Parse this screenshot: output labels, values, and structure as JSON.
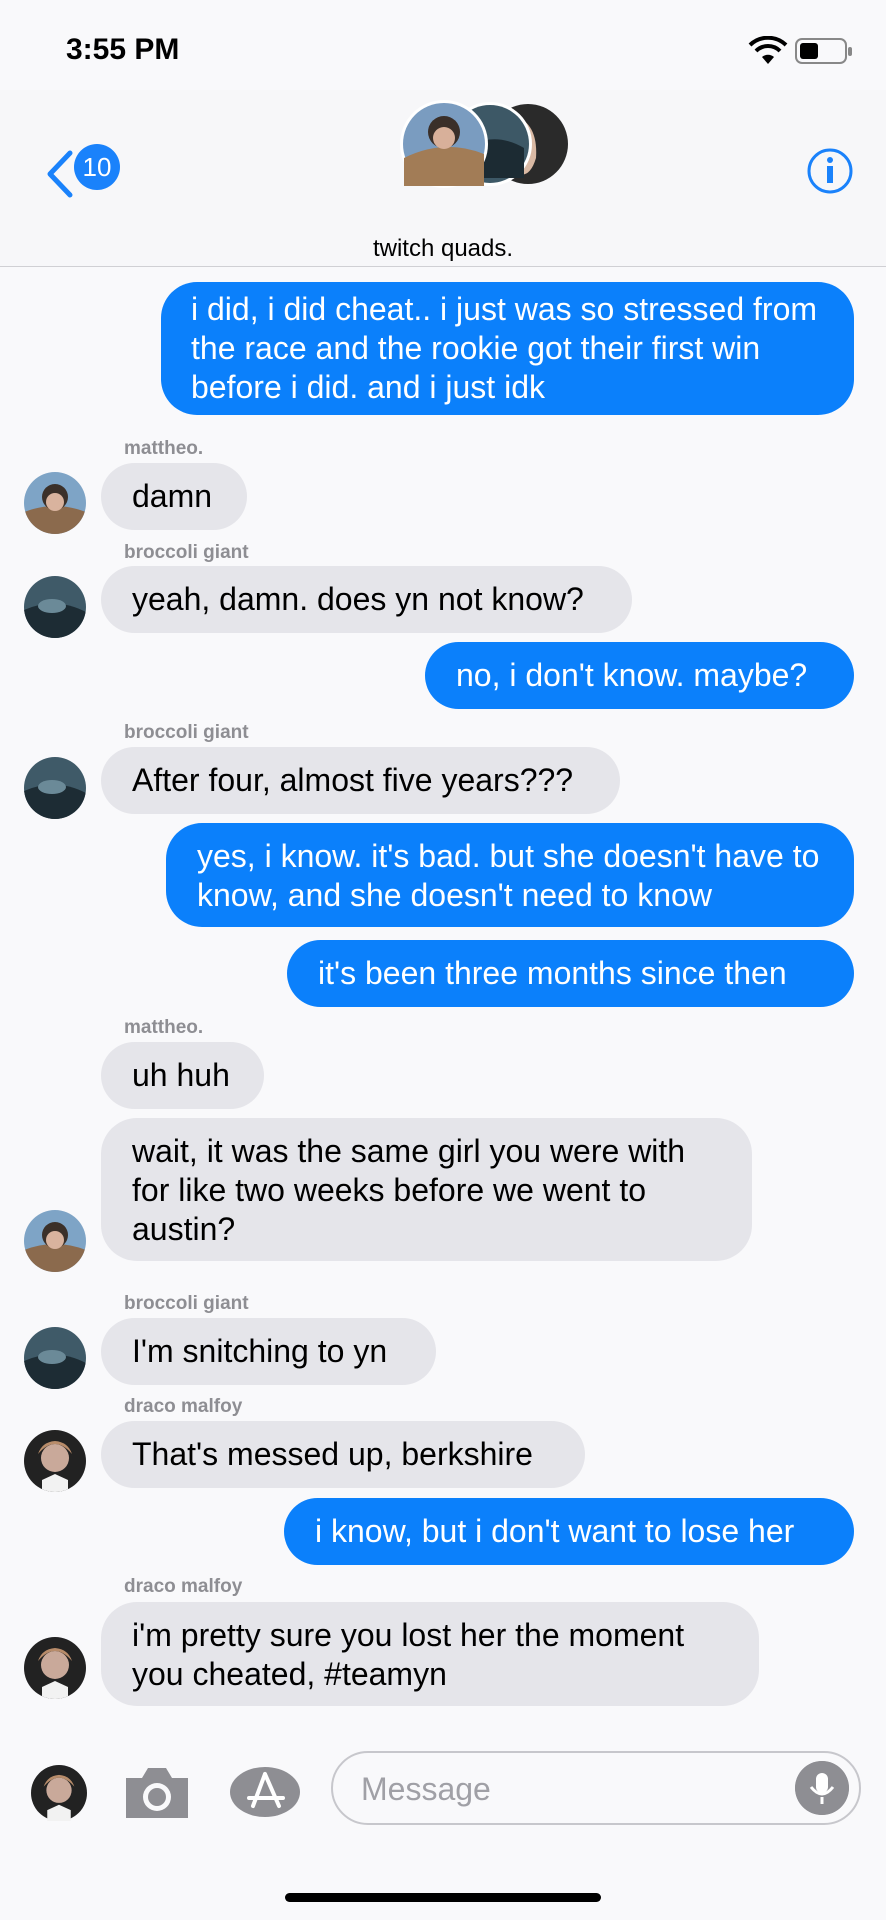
{
  "status": {
    "time": "3:55 PM"
  },
  "header": {
    "title": "twitch quads.",
    "unread_count": "10"
  },
  "messages": [
    {
      "dir": "out",
      "text": "i did, i did cheat.. i just was so stressed from the race and the rookie got their first win before i did. and i just idk"
    },
    {
      "dir": "in",
      "sender": "mattheo.",
      "text": "damn"
    },
    {
      "dir": "in",
      "sender": "broccoli giant",
      "text": "yeah, damn. does yn not know?"
    },
    {
      "dir": "out",
      "text": "no, i don't know. maybe?"
    },
    {
      "dir": "in",
      "sender": "broccoli giant",
      "text": "After four, almost five years???"
    },
    {
      "dir": "out",
      "text": "yes, i know. it's bad. but she doesn't have to know, and she doesn't need to know"
    },
    {
      "dir": "out",
      "text": "it's been three months since then"
    },
    {
      "dir": "in",
      "sender": "mattheo.",
      "text": "uh huh"
    },
    {
      "dir": "in",
      "text": "wait, it was the same girl you were with for like two weeks before we went to austin?"
    },
    {
      "dir": "in",
      "sender": "broccoli giant",
      "text": "I'm snitching to yn"
    },
    {
      "dir": "in",
      "sender": "draco malfoy",
      "text": "That's messed up, berkshire"
    },
    {
      "dir": "out",
      "text": "i know, but i don't want to lose her"
    },
    {
      "dir": "in",
      "sender": "draco malfoy",
      "text": "i'm pretty sure you lost her the moment you cheated, #teamyn"
    }
  ],
  "composer": {
    "placeholder": "Message"
  },
  "icons": [
    "back-chevron-icon",
    "info-icon",
    "camera-icon",
    "app-store-icon",
    "microphone-icon",
    "wifi-icon",
    "battery-icon"
  ],
  "colors": {
    "outgoing": "#0b80fb",
    "incoming": "#e5e5ea",
    "accent": "#1a82fb"
  }
}
